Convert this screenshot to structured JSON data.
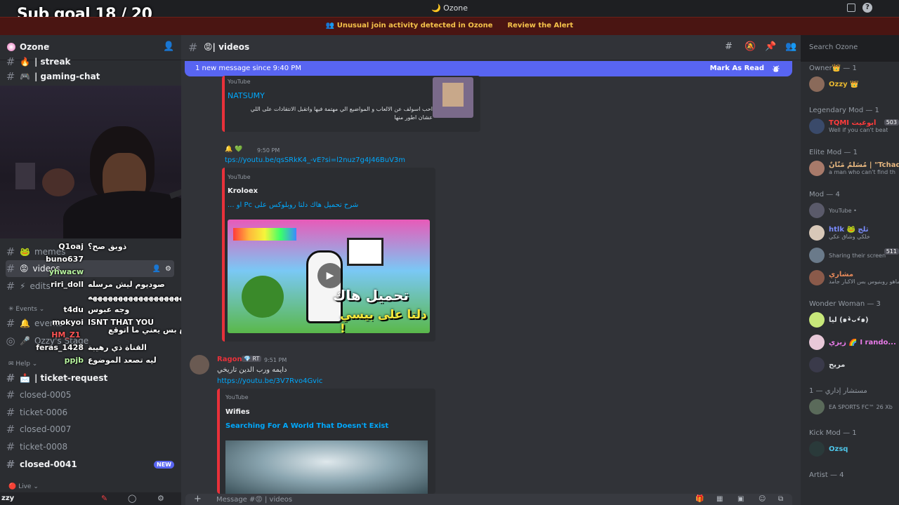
{
  "window": {
    "title": "Ozone"
  },
  "overlay": {
    "subgoal": "Sub goal 18 / 20"
  },
  "notice": {
    "text": "Unusual join activity detected in Ozone",
    "action": "Review the Alert"
  },
  "server": {
    "name": "Ozone"
  },
  "sidebar": {
    "channels_top": [
      {
        "label": "| streak",
        "emoji": "🔥"
      },
      {
        "label": "| gaming-chat",
        "emoji": "🎮"
      }
    ],
    "channels_mid": [
      {
        "label": "memes",
        "emoji": "🐸"
      },
      {
        "label": "videos",
        "emoji": "😡"
      },
      {
        "label": "edits",
        "emoji": "⚡"
      }
    ],
    "events_category": "Events",
    "events_channels": [
      "events",
      "Ozzy's Stage"
    ],
    "help_category": "Help",
    "help_channels": [
      {
        "label": "| ticket-request",
        "unread": true
      },
      {
        "label": "closed-0005",
        "unread": false
      },
      {
        "label": "ticket-0006",
        "unread": false
      },
      {
        "label": "closed-0007",
        "unread": false
      },
      {
        "label": "ticket-0008",
        "unread": false
      },
      {
        "label": "closed-0041",
        "unread": true
      }
    ],
    "new_badge": "NEW",
    "live_category": "Live",
    "user_short": "zzy"
  },
  "stream_chat": [
    {
      "user": "Q1oaj",
      "msg": "ذويق صح؟",
      "color": "#ffffff"
    },
    {
      "user": "buno637",
      "msg": "",
      "color": "#ffffff"
    },
    {
      "user": "yhwacw",
      "msg": "",
      "color": "#b8f5a0"
    },
    {
      "user": "riri_doll",
      "msg": "صوديوم ليش مرسله",
      "color": "#ffffff"
    },
    {
      "user": "",
      "msg": "ههههههههههههههههههههههه",
      "color": "#ffffff"
    },
    {
      "user": "t4du",
      "msg": "وجه عبوس",
      "color": "#ffffff"
    },
    {
      "user": "mokyoi",
      "msg": "ISNT THAT YOU",
      "color": "#ffffff"
    },
    {
      "user": "HM_Z1",
      "msg": "حلو المقطع بس يعني ما اتوقع بيعجبك",
      "color": "#ff5555"
    },
    {
      "user": "feras_1428",
      "msg": "القناة ذي رهيبة",
      "color": "#ffffff"
    },
    {
      "user": "ppjb",
      "msg": "ليه تصعد الموضوع",
      "color": "#b8f5a0"
    }
  ],
  "channel": {
    "name": "| videos",
    "emoji": "😡"
  },
  "newbar": {
    "text": "1 new message since 9:40 PM",
    "action": "Mark As Read"
  },
  "messages": {
    "embed1": {
      "provider": "YouTube",
      "title": "NATSUMY",
      "desc": "احب اسولف عن الالعاب و المواضيع الي مهتمة فيها واتقبل الانتقادات على اللي عشان اطور منها"
    },
    "msg2": {
      "time": "9:50 PM",
      "link": "tps://youtu.be/qsSRkK4_-vE?si=l2nuz7g4J46BuV3m"
    },
    "embed2": {
      "provider": "YouTube",
      "author": "Kroloex",
      "title": "شرح تحميل هاك دلتا روبلوكس على Pc او ...",
      "thumb_text_1": "تحميل هاك",
      "thumb_text_2": "دلتا على بيسي !"
    },
    "msg3": {
      "author": "Ragon",
      "badge": "RT",
      "time": "9:51 PM",
      "text": "دايمه ورب الدين تاريخي",
      "link": "https://youtu.be/3V7Rvo4Gvic"
    },
    "embed3": {
      "provider": "YouTube",
      "author": "Wifies",
      "title": "Searching For A World That Doesn't Exist"
    }
  },
  "composer": {
    "placeholder": "Message #😡 | videos"
  },
  "members": {
    "search_placeholder": "Search Ozone",
    "groups": [
      {
        "role": "Owner👑 — 1",
        "members": [
          {
            "name": "Ozzy 👑",
            "status": "",
            "color": "#e8b830"
          }
        ]
      },
      {
        "role": "Legendary Mod — 1",
        "members": [
          {
            "name": "TQMI أبوغيث",
            "status": "Well if you can't beat",
            "color": "#ff3b3b",
            "tag": "503"
          }
        ]
      },
      {
        "role": "Elite Mod — 1",
        "members": [
          {
            "name": "مُسَلِّمٌ مَنَّانٌ | \"Tchad\" G.",
            "status": "a man who can't find th",
            "color": "#e8b880"
          }
        ]
      },
      {
        "role": "Mod — 4",
        "members": [
          {
            "name": "",
            "status": "YouTube •",
            "color": "#ffffff",
            "tag": ""
          },
          {
            "name": "htlk 🐸 ثلج",
            "status": "خلكي وشاق عكي",
            "color": "#7a8cff"
          },
          {
            "name": "",
            "status": "Sharing their screen",
            "color": "#ff3b3b",
            "tag": "511"
          },
          {
            "name": "مشاري",
            "status": "لا ماهو روبنيوس بس الاكبار جامد",
            "color": "#e88a5a"
          }
        ]
      },
      {
        "role": "Wonder Woman — 3",
        "members": [
          {
            "name": "ليا (๑•̀ᴗ•́๑)",
            "status": "",
            "color": "#dbdee1"
          },
          {
            "name": "زيزي 🌈 I rando...",
            "status": "",
            "color": "#e87ae8"
          },
          {
            "name": "مريح",
            "status": "",
            "color": "#dbdee1"
          }
        ]
      },
      {
        "role": "مستشار إداري — 1",
        "members": [
          {
            "name": "",
            "status": "EA SPORTS FC™ 26 Xb",
            "color": "#dbdee1"
          }
        ]
      },
      {
        "role": "Kick Mod — 1",
        "members": [
          {
            "name": "Ozsq",
            "status": "",
            "color": "#4ec5e8"
          }
        ]
      },
      {
        "role": "Artist — 4",
        "members": []
      }
    ]
  },
  "colors": {
    "accent": "#5865f2",
    "link": "#00a8fc",
    "embed_red": "#e8313a"
  }
}
